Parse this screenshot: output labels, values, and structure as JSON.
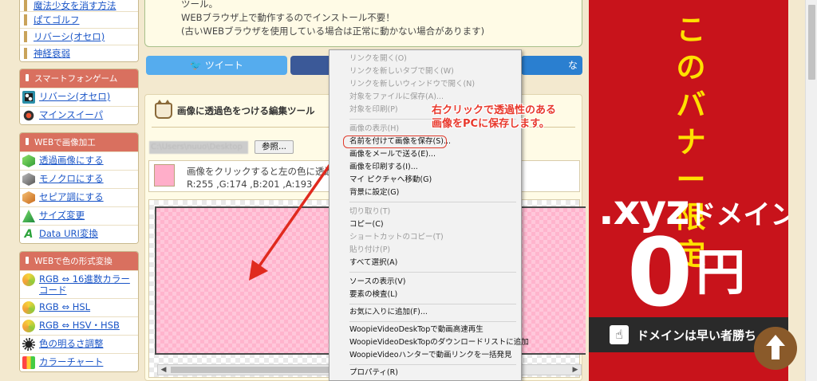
{
  "sidebar": {
    "top_items": [
      {
        "label": "魔法少女を消す方法",
        "icon": "bar-icon"
      },
      {
        "label": "ぱてゴルフ",
        "icon": "bar-icon"
      },
      {
        "label": "リバーシ(オセロ)",
        "icon": "bar-icon"
      },
      {
        "label": "神経衰弱",
        "icon": "bar-icon"
      }
    ],
    "smartphone": {
      "heading": "スマートフォンゲーム",
      "items": [
        {
          "label": "リバーシ(オセロ)",
          "icon": "reversi-icon"
        },
        {
          "label": "マインスイーパ",
          "icon": "mine-icon"
        }
      ]
    },
    "image_tools": {
      "heading": "WEBで画像加工",
      "items": [
        {
          "label": "透過画像にする",
          "icon": "green-cube-icon"
        },
        {
          "label": "モノクロにする",
          "icon": "gray-cube-icon"
        },
        {
          "label": "セピア調にする",
          "icon": "orange-cube-icon"
        },
        {
          "label": "サイズ変更",
          "icon": "pyramid-icon"
        },
        {
          "label": "Data URI変換",
          "icon": "a-letter-icon"
        }
      ]
    },
    "color_tools": {
      "heading": "WEBで色の形式変換",
      "items": [
        {
          "label": "RGB ⇔ 16進数カラーコード",
          "icon": "rgb-icon"
        },
        {
          "label": "RGB ⇔ HSL",
          "icon": "rgb-icon"
        },
        {
          "label": "RGB ⇔ HSV・HSB",
          "icon": "rgb-icon"
        },
        {
          "label": "色の明るさ調整",
          "icon": "brightness-icon"
        },
        {
          "label": "カラーチャート",
          "icon": "chart-icon"
        }
      ]
    }
  },
  "description": {
    "line1": "ツール。",
    "line2": "WEBブラウザ上で動作するのでインストール不要！",
    "line3": "(古いWEBブラウザを使用している場合は正常に動かない場合があります)"
  },
  "share": {
    "tweet_label": "ツイート",
    "hatena_tail": "な"
  },
  "tool": {
    "title": "画像に透過色をつける編集ツール",
    "file_path": "C:\\Users\\nuuo\\Desktop",
    "browse_label": "参照...",
    "instruction": "画像をクリックすると左の色に透過色",
    "rgba": "R:255 ,G:174 ,B:201 ,A:193",
    "swatch_color": "#ffaec9"
  },
  "context_menu": {
    "items": [
      {
        "label": "リンクを開く(O)",
        "disabled": true
      },
      {
        "label": "リンクを新しいタブで開く(W)",
        "disabled": true
      },
      {
        "label": "リンクを新しいウィンドウで開く(N)",
        "disabled": true
      },
      {
        "label": "対象をファイルに保存(A)...",
        "disabled": true
      },
      {
        "label": "対象を印刷(P)",
        "disabled": true
      },
      {
        "label": "画像の表示(H)",
        "disabled": true
      },
      {
        "label": "名前を付けて画像を保存(S)...",
        "disabled": false,
        "highlighted": true
      },
      {
        "label": "画像をメールで送る(E)...",
        "disabled": false
      },
      {
        "label": "画像を印刷する(I)...",
        "disabled": false
      },
      {
        "label": "マイ ピクチャへ移動(G)",
        "disabled": false
      },
      {
        "label": "背景に設定(G)",
        "disabled": false
      },
      {
        "label": "切り取り(T)",
        "disabled": true
      },
      {
        "label": "コピー(C)",
        "disabled": false
      },
      {
        "label": "ショートカットのコピー(T)",
        "disabled": true
      },
      {
        "label": "貼り付け(P)",
        "disabled": true
      },
      {
        "label": "すべて選択(A)",
        "disabled": false
      },
      {
        "label": "ソースの表示(V)",
        "disabled": false
      },
      {
        "label": "要素の検査(L)",
        "disabled": false
      },
      {
        "label": "お気に入りに追加(F)...",
        "disabled": false
      },
      {
        "label": "WoopieVideoDeskTopで動画高速再生",
        "disabled": false
      },
      {
        "label": "WoopieVideoDeskTopのダウンロードリストに追加",
        "disabled": false
      },
      {
        "label": "WoopieVideoハンターで動画リンクを一括発見",
        "disabled": false
      },
      {
        "label": "プロパティ(R)",
        "disabled": false
      }
    ]
  },
  "annotation": {
    "line1": "右クリックで透過性のある",
    "line2": "画像をPCに保存します。",
    "color": "#e8382c"
  },
  "ad": {
    "headline": "このバナー限定",
    "domain": ".xyz",
    "domain_suffix": "ドメイン",
    "price": "0",
    "currency": "円",
    "tagline": "ドメインは早い者勝ち",
    "bg_color": "#c8131b",
    "headline_color": "#ffe100"
  }
}
